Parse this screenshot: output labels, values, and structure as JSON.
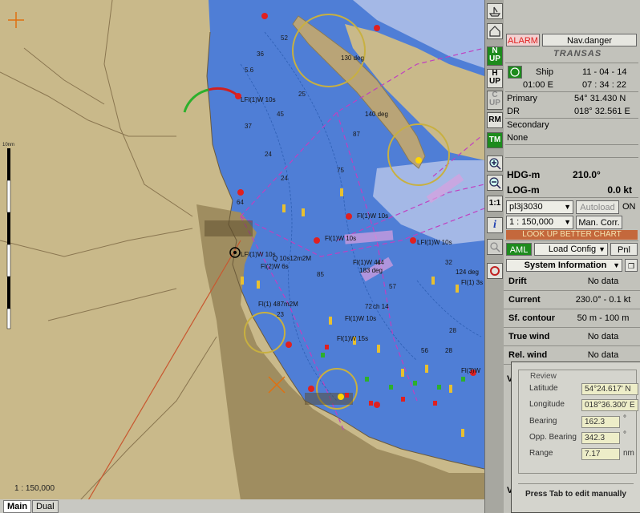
{
  "chart": {
    "scale_label": "1 : 150,000",
    "scale_bar_label": "10nm",
    "labels": [
      {
        "text": "LFl(1)W 10s"
      },
      {
        "text": "LFl(1)W 10s"
      },
      {
        "text": "Fl(1)W 10s"
      },
      {
        "text": "Fl(1)W 10s"
      },
      {
        "text": "LFl(1)W 10s"
      },
      {
        "text": "Fl(1)W 4s"
      },
      {
        "text": "183 deg"
      },
      {
        "text": "Fl(1) 3s"
      },
      {
        "text": "Fl(2)W 6s"
      },
      {
        "text": "Fl(1) 487m2M"
      },
      {
        "text": "Q 10s12m2M"
      },
      {
        "text": "Fl(1)W 15s"
      },
      {
        "text": "Fl(1)W 10s"
      },
      {
        "text": "Fl(3)W"
      },
      {
        "text": "140 deg"
      },
      {
        "text": "130 deg"
      },
      {
        "text": "124 deg"
      },
      {
        "text": "ch 14"
      },
      {
        "text": "28"
      },
      {
        "text": "56"
      }
    ]
  },
  "tabs": {
    "main": "Main",
    "dual": "Dual"
  },
  "toolbar": {
    "north_up": "N UP",
    "head_up": "H UP",
    "course_up": "C UP",
    "rm": "RM",
    "tm": "TM",
    "one_to_one": "1:1",
    "info": "i"
  },
  "panel": {
    "alarm": "ALARM",
    "nav_danger": "Nav.danger",
    "brand": "TRANSAS",
    "ship_label": "Ship",
    "date": "11 - 04 - 14",
    "zone": "01:00 E",
    "time": "07 : 34 : 22",
    "primary_label": "Primary",
    "primary_lat": "54° 31.430 N",
    "dr_label": "DR",
    "dr_lon": "018° 32.561 E",
    "secondary_label": "Secondary",
    "secondary_value": "None",
    "hdg_label": "HDG-m",
    "hdg_value": "210.0°",
    "log_label": "LOG-m",
    "log_value": "0.0 kt",
    "chart_name": "pl3j3030",
    "autoload": "Autoload",
    "on": "ON",
    "scale": "1 : 150,000",
    "man_corr": "Man. Corr.",
    "look_up": "LOOK UP BETTER CHART",
    "aml": "AML",
    "load_config": "Load Config",
    "pnl": "Pnl",
    "sys_info": "System Information",
    "info_rows": [
      {
        "label": "Drift",
        "value": "No data"
      },
      {
        "label": "Current",
        "value": "230.0° - 0.1 kt"
      },
      {
        "label": "Sf. contour",
        "value": "50 m - 100 m"
      },
      {
        "label": "True wind",
        "value": "No data"
      },
      {
        "label": "Rel. wind",
        "value": "No data"
      }
    ],
    "partial_v1": "V",
    "partial_v2": "V"
  },
  "review": {
    "title": "Review",
    "latitude_label": "Latitude",
    "latitude_value": "54°24.617' N",
    "longitude_label": "Longitude",
    "longitude_value": "018°36.300' E",
    "bearing_label": "Bearing",
    "bearing_value": "162.3",
    "bearing_unit": "°",
    "opp_bearing_label": "Opp. Bearing",
    "opp_bearing_value": "342.3",
    "opp_bearing_unit": "°",
    "range_label": "Range",
    "range_value": "7.17",
    "range_unit": "nm",
    "hint": "Press Tab to edit manually"
  },
  "colors": {
    "land": "#c9b98a",
    "sea": "#4f7ed6",
    "shallow": "#a4b8e6",
    "route": "#c040c0",
    "alarm": "#e02020",
    "green": "#1d8b1d"
  }
}
